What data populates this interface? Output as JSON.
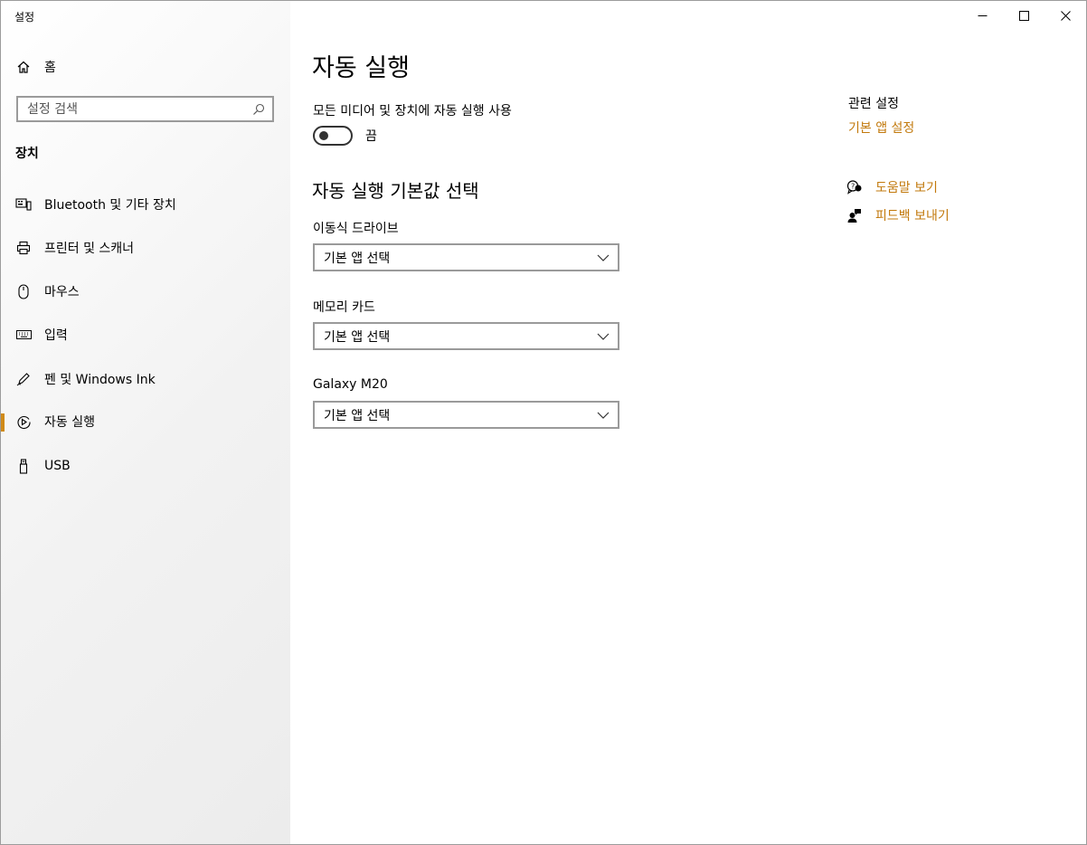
{
  "window": {
    "title": "설정"
  },
  "sidebar": {
    "home_label": "홈",
    "search_placeholder": "설정 검색",
    "section_title": "장치",
    "items": [
      {
        "label": "Bluetooth 및 기타 장치",
        "icon": "bluetooth-devices-icon",
        "selected": false
      },
      {
        "label": "프린터 및 스캐너",
        "icon": "printer-icon",
        "selected": false
      },
      {
        "label": "마우스",
        "icon": "mouse-icon",
        "selected": false
      },
      {
        "label": "입력",
        "icon": "keyboard-icon",
        "selected": false
      },
      {
        "label": "펜 및 Windows Ink",
        "icon": "pen-icon",
        "selected": false
      },
      {
        "label": "자동 실행",
        "icon": "autoplay-icon",
        "selected": true
      },
      {
        "label": "USB",
        "icon": "usb-icon",
        "selected": false
      }
    ]
  },
  "main": {
    "title": "자동 실행",
    "toggle": {
      "label": "모든 미디어 및 장치에 자동 실행 사용",
      "state_text": "끔",
      "on": false
    },
    "defaults_title": "자동 실행 기본값 선택",
    "fields": [
      {
        "label": "이동식 드라이브",
        "value": "기본 앱 선택"
      },
      {
        "label": "메모리 카드",
        "value": "기본 앱 선택"
      },
      {
        "label": "Galaxy M20",
        "value": "기본 앱 선택"
      }
    ]
  },
  "related": {
    "title": "관련 설정",
    "link": "기본 앱 설정",
    "help_label": "도움말 보기",
    "feedback_label": "피드백 보내기"
  },
  "colors": {
    "accent": "#c2790c",
    "selection_indicator": "#d08a18"
  }
}
